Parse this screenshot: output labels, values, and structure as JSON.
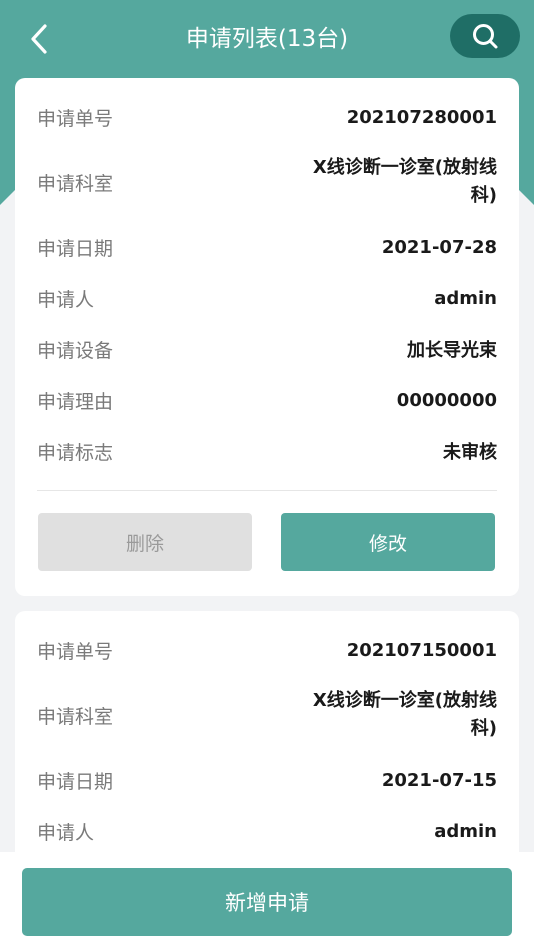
{
  "header": {
    "title": "申请列表(13台)",
    "back_icon": "chevron-left-icon",
    "search_icon": "search-icon"
  },
  "colors": {
    "primary": "#55a89e",
    "search_bg": "#1f6e66",
    "disabled_bg": "#e0e0e0"
  },
  "field_labels": {
    "number": "申请单号",
    "dept": "申请科室",
    "date": "申请日期",
    "person": "申请人",
    "device": "申请设备",
    "reason": "申请理由",
    "flag": "申请标志"
  },
  "cards": [
    {
      "number": "202107280001",
      "dept": "X线诊断一诊室(放射线科)",
      "date": "2021-07-28",
      "person": "admin",
      "device": "加长导光束",
      "reason": "00000000",
      "flag": "未审核",
      "delete_label": "删除",
      "edit_label": "修改"
    },
    {
      "number": "202107150001",
      "dept": "X线诊断一诊室(放射线科)",
      "date": "2021-07-15",
      "person": "admin"
    }
  ],
  "footer": {
    "add_label": "新增申请"
  }
}
